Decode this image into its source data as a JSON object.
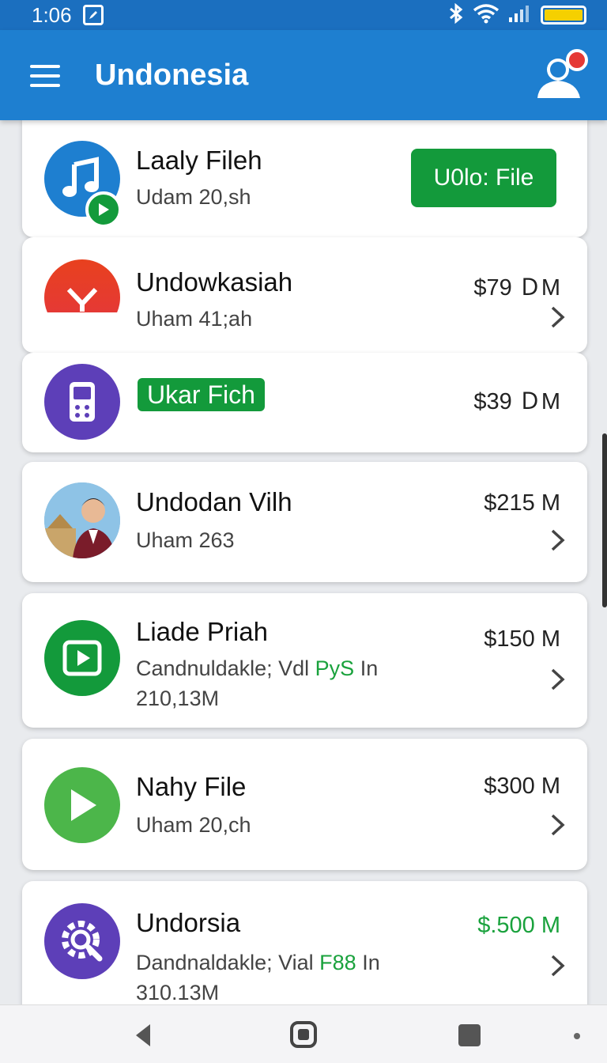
{
  "status_bar": {
    "time": "1:06",
    "bluetooth_icon": "bluetooth-icon",
    "wifi_icon": "wifi-icon",
    "signal_icon": "signal-icon",
    "battery_color": "#f5d000"
  },
  "app_bar": {
    "title": "Undonesia",
    "background": "#1e7fd0",
    "menu_icon": "hamburger-menu-icon",
    "user_icon": "user-notification-icon"
  },
  "items": [
    {
      "icon": "music-note-icon",
      "title": "Laaly Fileh",
      "subtitle": "Udam 20,sh",
      "button_label": "U0lo: File"
    },
    {
      "icon": "red-chevron-icon",
      "title": "Undowkasiah",
      "subtitle": "Uham 41;ah",
      "price": "$79 ＤM"
    },
    {
      "icon": "device-icon",
      "tag": "Ukar Fich",
      "price": "$39 ＤM"
    },
    {
      "icon": "profile-photo",
      "title": "Undodan Vilh",
      "subtitle": "Uham 263",
      "price": "$215 M"
    },
    {
      "icon": "play-icon",
      "title": "Liade Рriah",
      "subtitle_prefix": "Candnuldakle; Vdl ",
      "subtitle_highlight": "PyS",
      "subtitle_suffix": " In",
      "subtitle_line2": "210,13M",
      "price": "$150 M"
    },
    {
      "icon": "play-icon",
      "title": "Nahy File",
      "subtitle": "Uham 20,ch",
      "price": "$300 M"
    },
    {
      "icon": "settings-search-icon",
      "title": "Undorsia",
      "subtitle_prefix": "Dandnaldakle; Vial ",
      "subtitle_highlight": "F88",
      "subtitle_suffix": " In",
      "subtitle_line2": "310.13M",
      "price": "$.500 M",
      "price_color": "#1aa23d"
    }
  ],
  "nav_bar": {
    "back_icon": "back-triangle-icon",
    "home_icon": "home-icon",
    "recents_icon": "recents-icon"
  }
}
